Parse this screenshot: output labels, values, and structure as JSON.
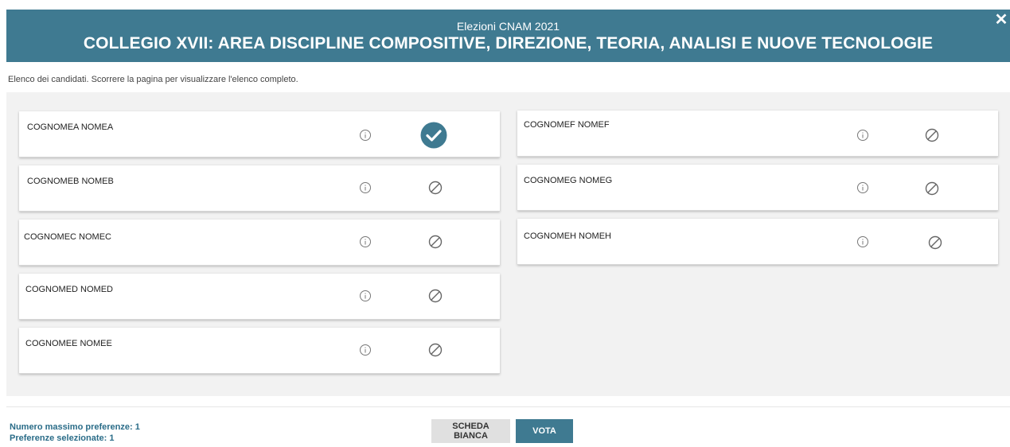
{
  "header": {
    "subtitle": "Elezioni CNAM 2021",
    "title": "COLLEGIO XVII: AREA DISCIPLINE COMPOSITIVE, DIREZIONE, TEORIA, ANALISI E NUOVE TECNOLOGIE",
    "close_label": "✕"
  },
  "instructions": "Elenco dei candidati. Scorrere la pagina per visualizzare l'elenco completo.",
  "candidates": [
    {
      "name": "COGNOMEA NOMEA",
      "selected": true
    },
    {
      "name": "COGNOMEB NOMEB",
      "selected": false
    },
    {
      "name": "COGNOMEC NOMEC",
      "selected": false
    },
    {
      "name": "COGNOMED NOMED",
      "selected": false
    },
    {
      "name": "COGNOMEE NOMEE",
      "selected": false
    },
    {
      "name": "COGNOMEF NOMEF",
      "selected": false
    },
    {
      "name": "COGNOMEG NOMEG",
      "selected": false
    },
    {
      "name": "COGNOMEH NOMEH",
      "selected": false
    }
  ],
  "footer": {
    "max_preferences": "Numero massimo preferenze: 1",
    "selected_preferences": "Preferenze selezionate: 1",
    "blank_label": "SCHEDA BIANCA",
    "vote_label": "VOTA"
  },
  "colors": {
    "accent": "#3f7a91",
    "icon_gray": "#777777"
  },
  "icons": {
    "info": "info-icon",
    "ban": "ban-icon",
    "check": "check-circle-icon",
    "close": "close-icon"
  }
}
